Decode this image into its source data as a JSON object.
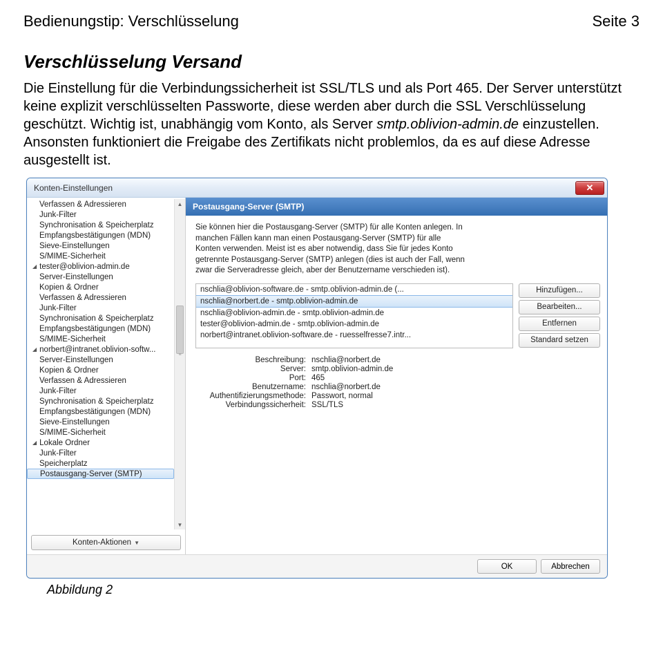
{
  "doc": {
    "header_left": "Bedienungstip: Verschlüsselung",
    "header_right": "Seite 3",
    "heading": "Verschlüsselung Versand",
    "para_plain_1": "Die Einstellung für die Verbindungssicherheit ist SSL/TLS und als Port 465. Der Server unterstützt keine explizit verschlüsselten Passworte, diese werden aber durch die SSL Verschlüsselung geschützt. Wichtig ist, unabhängig vom Konto, als Server ",
    "para_italic": "smtp.oblivion-admin.de",
    "para_plain_2": " einzustellen. Ansonsten funktioniert die Freigabe des Zertifikats nicht problemlos, da es auf diese Adresse ausgestellt ist.",
    "figure_caption": "Abbildung 2"
  },
  "window": {
    "title": "Konten-Einstellungen",
    "close_glyph": "✕"
  },
  "sidebar": {
    "items": [
      {
        "label": "Verfassen & Adressieren",
        "type": "sub"
      },
      {
        "label": "Junk-Filter",
        "type": "sub"
      },
      {
        "label": "Synchronisation & Speicherplatz",
        "type": "sub"
      },
      {
        "label": "Empfangsbestätigungen (MDN)",
        "type": "sub"
      },
      {
        "label": "Sieve-Einstellungen",
        "type": "sub"
      },
      {
        "label": "S/MIME-Sicherheit",
        "type": "sub"
      },
      {
        "label": "tester@oblivion-admin.de",
        "type": "account"
      },
      {
        "label": "Server-Einstellungen",
        "type": "sub"
      },
      {
        "label": "Kopien & Ordner",
        "type": "sub"
      },
      {
        "label": "Verfassen & Adressieren",
        "type": "sub"
      },
      {
        "label": "Junk-Filter",
        "type": "sub"
      },
      {
        "label": "Synchronisation & Speicherplatz",
        "type": "sub"
      },
      {
        "label": "Empfangsbestätigungen (MDN)",
        "type": "sub"
      },
      {
        "label": "S/MIME-Sicherheit",
        "type": "sub"
      },
      {
        "label": "norbert@intranet.oblivion-softw...",
        "type": "account"
      },
      {
        "label": "Server-Einstellungen",
        "type": "sub"
      },
      {
        "label": "Kopien & Ordner",
        "type": "sub"
      },
      {
        "label": "Verfassen & Adressieren",
        "type": "sub"
      },
      {
        "label": "Junk-Filter",
        "type": "sub"
      },
      {
        "label": "Synchronisation & Speicherplatz",
        "type": "sub"
      },
      {
        "label": "Empfangsbestätigungen (MDN)",
        "type": "sub"
      },
      {
        "label": "Sieve-Einstellungen",
        "type": "sub"
      },
      {
        "label": "S/MIME-Sicherheit",
        "type": "sub"
      },
      {
        "label": "Lokale Ordner",
        "type": "account"
      },
      {
        "label": "Junk-Filter",
        "type": "sub"
      },
      {
        "label": "Speicherplatz",
        "type": "sub"
      },
      {
        "label": "Postausgang-Server (SMTP)",
        "type": "sub",
        "selected": true
      }
    ],
    "actions_label": "Konten-Aktionen"
  },
  "main": {
    "header": "Postausgang-Server (SMTP)",
    "description": "Sie können hier die Postausgang-Server (SMTP) für alle Konten anlegen. In manchen Fällen kann man einen Postausgang-Server (SMTP) für alle Konten verwenden. Meist ist es aber notwendig, dass Sie für jedes Konto getrennte Postausgang-Server (SMTP) anlegen (dies ist auch der Fall, wenn zwar die Serveradresse gleich, aber der Benutzername verschieden ist)."
  },
  "list": {
    "rows": [
      {
        "text": "nschlia@oblivion-software.de - smtp.oblivion-admin.de (...",
        "selected": false
      },
      {
        "text": "nschlia@norbert.de - smtp.oblivion-admin.de",
        "selected": true
      },
      {
        "text": "nschlia@oblivion-admin.de - smtp.oblivion-admin.de",
        "selected": false
      },
      {
        "text": "tester@oblivion-admin.de - smtp.oblivion-admin.de",
        "selected": false
      },
      {
        "text": "norbert@intranet.oblivion-software.de - ruesselfresse7.intr...",
        "selected": false
      }
    ]
  },
  "buttons": {
    "add": "Hinzufügen...",
    "edit": "Bearbeiten...",
    "remove": "Entfernen",
    "default": "Standard setzen",
    "ok": "OK",
    "cancel": "Abbrechen"
  },
  "details": {
    "rows": [
      {
        "label": "Beschreibung:",
        "value": "nschlia@norbert.de"
      },
      {
        "label": "Server:",
        "value": "smtp.oblivion-admin.de"
      },
      {
        "label": "Port:",
        "value": "465"
      },
      {
        "label": "Benutzername:",
        "value": "nschlia@norbert.de"
      },
      {
        "label": "Authentifizierungsmethode:",
        "value": "Passwort, normal"
      },
      {
        "label": "Verbindungssicherheit:",
        "value": "SSL/TLS"
      }
    ]
  }
}
